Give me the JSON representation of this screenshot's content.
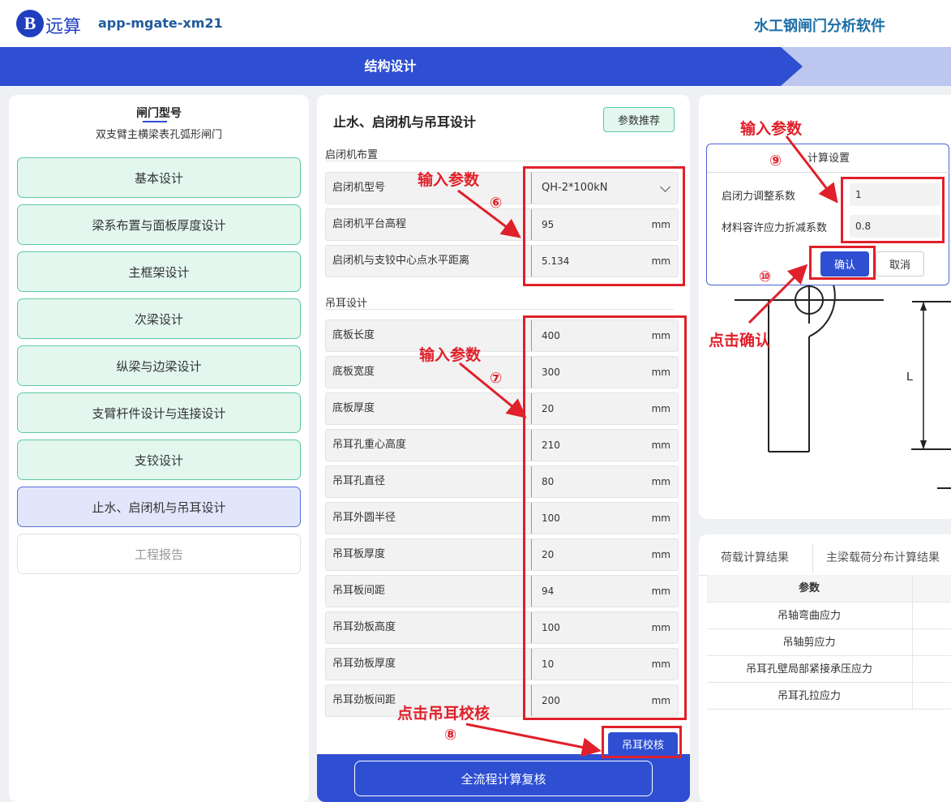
{
  "header": {
    "logo_letter": "B",
    "brand": "远算",
    "app_name": "app-mgate-xm21",
    "software_title": "水工钢闸门分析软件"
  },
  "stepbar": {
    "active_step": "结构设计"
  },
  "left": {
    "gate_type_title": "闸门型号",
    "gate_type_value": "双支臂主横梁表孔弧形闸门",
    "menu": [
      "基本设计",
      "梁系布置与面板厚度设计",
      "主框架设计",
      "次梁设计",
      "纵梁与边梁设计",
      "支臂杆件设计与连接设计",
      "支铰设计",
      "止水、启闭机与吊耳设计",
      "工程报告"
    ]
  },
  "middle": {
    "title": "止水、启闭机与吊耳设计",
    "recommend_btn": "参数推荐",
    "hoist_section": "启闭机布置",
    "hoist_model_label": "启闭机型号",
    "hoist_model_value": "QH-2*100kN",
    "hoist_params": [
      {
        "label": "启闭机平台高程",
        "value": "95",
        "unit": "mm"
      },
      {
        "label": "启闭机与支铰中心点水平距离",
        "value": "5.134",
        "unit": "mm"
      }
    ],
    "lug_section": "吊耳设计",
    "lug_params": [
      {
        "label": "底板长度",
        "value": "400",
        "unit": "mm"
      },
      {
        "label": "底板宽度",
        "value": "300",
        "unit": "mm"
      },
      {
        "label": "底板厚度",
        "value": "20",
        "unit": "mm"
      },
      {
        "label": "吊耳孔重心高度",
        "value": "210",
        "unit": "mm"
      },
      {
        "label": "吊耳孔直径",
        "value": "80",
        "unit": "mm"
      },
      {
        "label": "吊耳外圆半径",
        "value": "100",
        "unit": "mm"
      },
      {
        "label": "吊耳板厚度",
        "value": "20",
        "unit": "mm"
      },
      {
        "label": "吊耳板间距",
        "value": "94",
        "unit": "mm"
      },
      {
        "label": "吊耳劲板高度",
        "value": "100",
        "unit": "mm"
      },
      {
        "label": "吊耳劲板厚度",
        "value": "10",
        "unit": "mm"
      },
      {
        "label": "吊耳劲板间距",
        "value": "200",
        "unit": "mm"
      }
    ],
    "lug_check_btn": "吊耳校核",
    "full_calc_btn": "全流程计算复核"
  },
  "dialog": {
    "title": "计算设置",
    "fields": [
      {
        "label": "启闭力调整系数",
        "value": "1"
      },
      {
        "label": "材料容许应力折减系数",
        "value": "0.8"
      }
    ],
    "confirm": "确认",
    "cancel": "取消"
  },
  "diagram": {
    "dimension_label": "L"
  },
  "results": {
    "tabs": [
      "荷载计算结果",
      "主梁载荷分布计算结果"
    ],
    "header": "参数",
    "rows": [
      "吊轴弯曲应力",
      "吊轴剪应力",
      "吊耳孔壁局部紧接承压应力",
      "吊耳孔拉应力"
    ]
  },
  "annotations": {
    "input_params": "输入参数",
    "click_lug_check": "点击吊耳校核",
    "click_confirm": "点击确认",
    "n6": "⑥",
    "n7": "⑦",
    "n8": "⑧",
    "n9": "⑨",
    "n10": "⑩"
  },
  "colors": {
    "primary": "#2f4fd2",
    "menu_green_bg": "#e3f7ef",
    "menu_green_border": "#5ec9a0",
    "annotation_red": "#e0202a"
  }
}
